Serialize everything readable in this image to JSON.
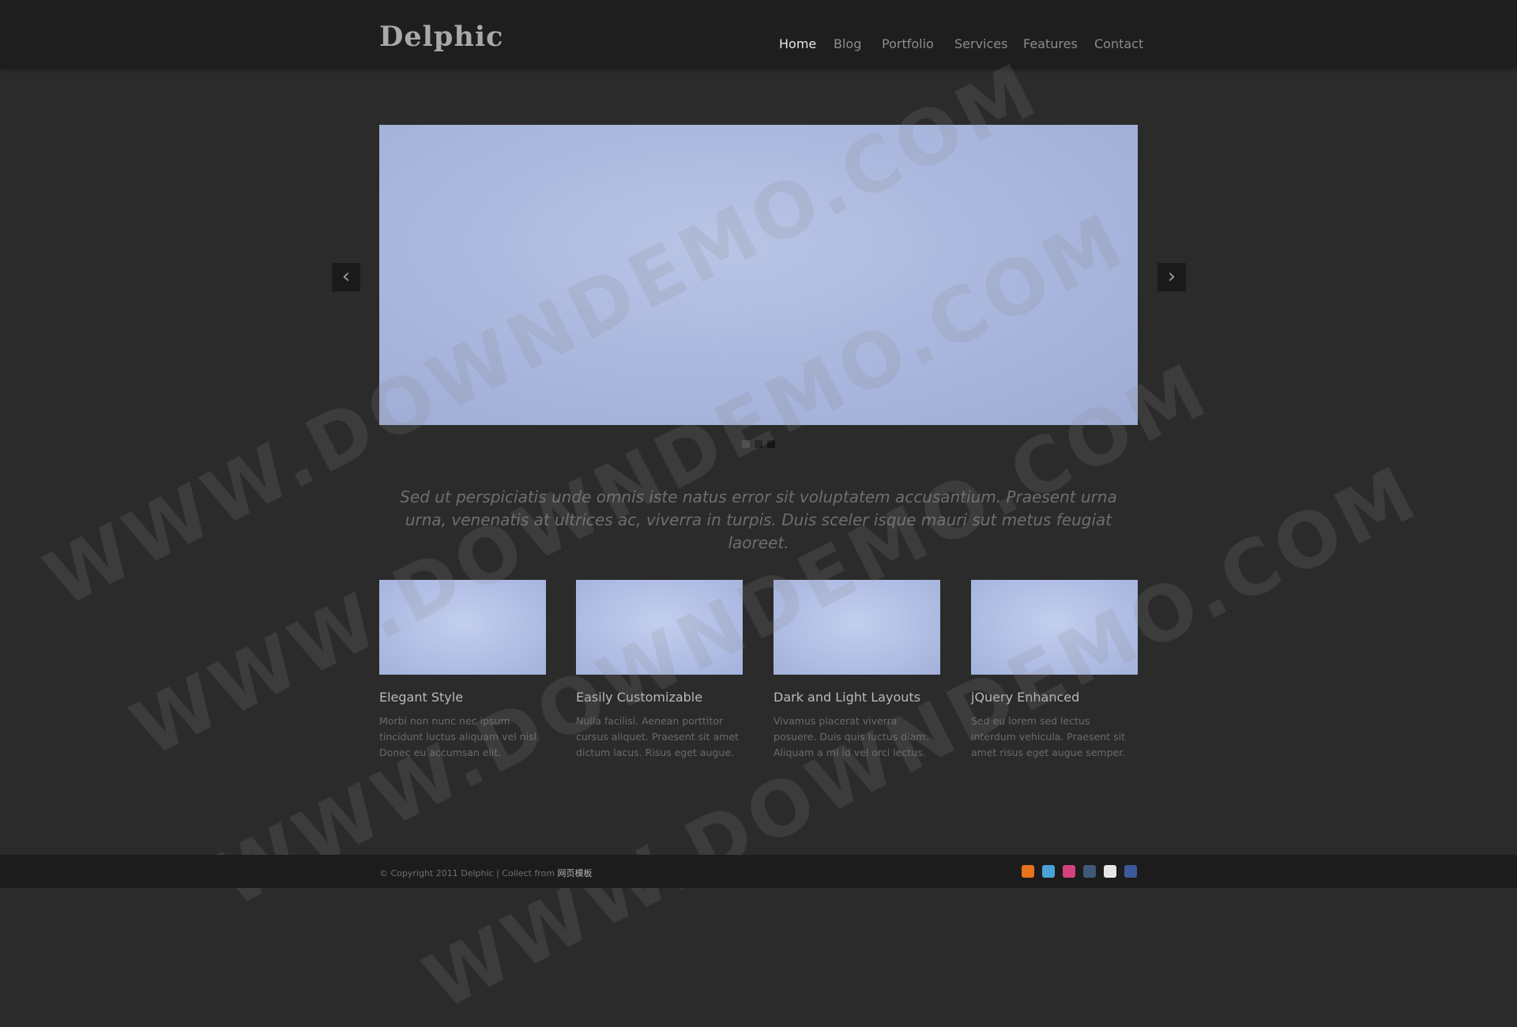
{
  "header": {
    "logo": "Delphic",
    "nav": [
      {
        "label": "Home",
        "active": true
      },
      {
        "label": "Blog",
        "active": false
      },
      {
        "label": "Portfolio",
        "active": false
      },
      {
        "label": "Services",
        "active": false
      },
      {
        "label": "Features",
        "active": false
      },
      {
        "label": "Contact",
        "active": false
      }
    ]
  },
  "slider": {
    "prev_icon": "chevron-left-icon",
    "next_icon": "chevron-right-icon",
    "prev_glyph": "‹",
    "next_glyph": "›",
    "slide_count": 3,
    "active_slide": 1
  },
  "tagline": "Sed ut perspiciatis unde omnis iste natus error sit voluptatem accusantium. Praesent urna urna, venenatis at ultrices ac, viverra in turpis. Duis sceler isque mauri sut metus feugiat laoreet.",
  "features": [
    {
      "title": "Elegant Style",
      "text": "Morbi non nunc nec ipsum tincidunt luctus aliquam vel nisl. Donec eu accumsan elit."
    },
    {
      "title": "Easily Customizable",
      "text": "Nulla facilisi. Aenean porttitor cursus aliquet. Praesent sit amet dictum lacus. Risus eget augue."
    },
    {
      "title": "Dark and Light Layouts",
      "text": "Vivamus placerat viverra posuere. Duis quis luctus diam. Aliquam a mi id vel orci lectus."
    },
    {
      "title": "jQuery Enhanced",
      "text": "Sed eu lorem sed lectus interdum vehicula. Praesent sit amet risus eget augue semper."
    }
  ],
  "watermark": "WWW.DOWNDEMO.COM",
  "footer": {
    "copyright": "© Copyright 2011 Delphic | Collect from ",
    "collect": "网页模板",
    "social": [
      {
        "icon": "rss-icon",
        "color": "#e8731b"
      },
      {
        "icon": "twitter-icon",
        "color": "#4aa3d8"
      },
      {
        "icon": "dribbble-icon",
        "color": "#d2437e"
      },
      {
        "icon": "tumblr-icon",
        "color": "#3f5a78"
      },
      {
        "icon": "flickr-icon",
        "color": "#e6e6e6"
      },
      {
        "icon": "facebook-icon",
        "color": "#3b5a9a"
      }
    ]
  }
}
